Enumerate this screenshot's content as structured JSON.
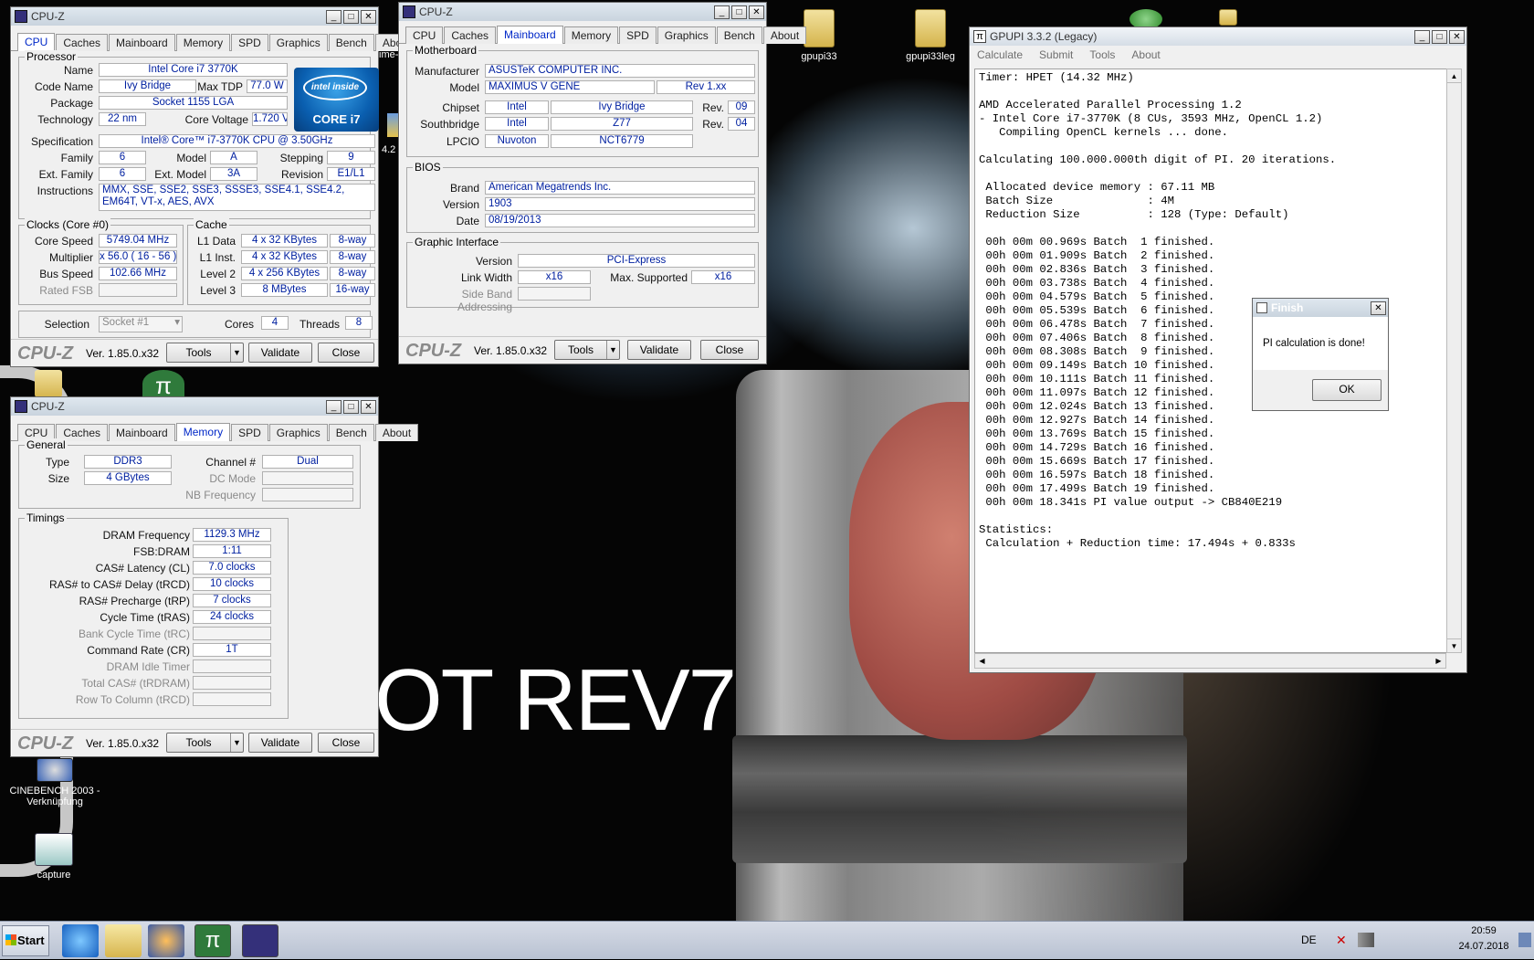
{
  "desktop": {
    "wallpaper_text": "OT REV7",
    "icons": [
      {
        "label": "gpupi33"
      },
      {
        "label": "gpupi33leg"
      },
      {
        "label": "CINEBENCH 2003 - Verknüpfung"
      },
      {
        "label": "capture"
      }
    ],
    "partial_label": "ime-",
    "partial_label2": "4.2"
  },
  "cpuz_cpu": {
    "title": "CPU-Z",
    "tabs": [
      "CPU",
      "Caches",
      "Mainboard",
      "Memory",
      "SPD",
      "Graphics",
      "Bench",
      "About"
    ],
    "active_tab": "CPU",
    "processor_group": "Processor",
    "name_label": "Name",
    "name": "Intel Core i7 3770K",
    "codename_label": "Code Name",
    "codename": "Ivy Bridge",
    "maxtdp_label": "Max TDP",
    "maxtdp": "77.0 W",
    "package_label": "Package",
    "package": "Socket 1155 LGA",
    "tech_label": "Technology",
    "tech": "22 nm",
    "corevolt_label": "Core Voltage",
    "corevolt": "1.720 V",
    "spec_label": "Specification",
    "spec": "Intel® Core™ i7-3770K CPU @ 3.50GHz",
    "family_label": "Family",
    "family": "6",
    "model_label": "Model",
    "model": "A",
    "stepping_label": "Stepping",
    "stepping": "9",
    "extfam_label": "Ext. Family",
    "extfam": "6",
    "extmodel_label": "Ext. Model",
    "extmodel": "3A",
    "revision_label": "Revision",
    "revision": "E1/L1",
    "instr_label": "Instructions",
    "instr": "MMX, SSE, SSE2, SSE3, SSSE3, SSE4.1, SSE4.2, EM64T, VT-x, AES, AVX",
    "clocks_group": "Clocks (Core #0)",
    "corespeed_label": "Core Speed",
    "corespeed": "5749.04 MHz",
    "mult_label": "Multiplier",
    "mult": "x 56.0 ( 16 - 56 )",
    "bus_label": "Bus Speed",
    "bus": "102.66 MHz",
    "fsb_label": "Rated FSB",
    "fsb": "",
    "cache_group": "Cache",
    "l1d_label": "L1 Data",
    "l1d": "4 x 32 KBytes",
    "l1d_way": "8-way",
    "l1i_label": "L1 Inst.",
    "l1i": "4 x 32 KBytes",
    "l1i_way": "8-way",
    "l2_label": "Level 2",
    "l2": "4 x 256 KBytes",
    "l2_way": "8-way",
    "l3_label": "Level 3",
    "l3": "8 MBytes",
    "l3_way": "16-way",
    "sel_label": "Selection",
    "sel": "Socket #1",
    "cores_label": "Cores",
    "cores": "4",
    "threads_label": "Threads",
    "threads": "8",
    "intel_logo": "intel inside",
    "intel_core": "CORE i7"
  },
  "cpuz_footer": {
    "logo": "CPU-Z",
    "version": "Ver. 1.85.0.x32",
    "tools": "Tools",
    "validate": "Validate",
    "close": "Close"
  },
  "cpuz_mb": {
    "title": "CPU-Z",
    "active_tab": "Mainboard",
    "mb_group": "Motherboard",
    "manuf_label": "Manufacturer",
    "manuf": "ASUSTeK COMPUTER INC.",
    "model_label": "Model",
    "model": "MAXIMUS V GENE",
    "model_rev": "Rev 1.xx",
    "chipset_label": "Chipset",
    "chipset_v": "Intel",
    "chipset_n": "Ivy Bridge",
    "chipset_rev_label": "Rev.",
    "chipset_rev": "09",
    "south_label": "Southbridge",
    "south_v": "Intel",
    "south_n": "Z77",
    "south_rev_label": "Rev.",
    "south_rev": "04",
    "lpcio_label": "LPCIO",
    "lpcio_v": "Nuvoton",
    "lpcio_n": "NCT6779",
    "bios_group": "BIOS",
    "brand_label": "Brand",
    "brand": "American Megatrends Inc.",
    "version_label": "Version",
    "version": "1903",
    "date_label": "Date",
    "date": "08/19/2013",
    "gi_group": "Graphic Interface",
    "giver_label": "Version",
    "giver": "PCI-Express",
    "lw_label": "Link Width",
    "lw": "x16",
    "maxsup_label": "Max. Supported",
    "maxsup": "x16",
    "sba_label": "Side Band Addressing",
    "sba": ""
  },
  "cpuz_mem": {
    "title": "CPU-Z",
    "active_tab": "Memory",
    "gen_group": "General",
    "type_label": "Type",
    "type": "DDR3",
    "size_label": "Size",
    "size": "4 GBytes",
    "channel_label": "Channel #",
    "channel": "Dual",
    "dc_label": "DC Mode",
    "dc": "",
    "nb_label": "NB Frequency",
    "nb": "",
    "tim_group": "Timings",
    "rows": [
      {
        "l": "DRAM Frequency",
        "v": "1129.3 MHz",
        "dim": false
      },
      {
        "l": "FSB:DRAM",
        "v": "1:11",
        "dim": false
      },
      {
        "l": "CAS# Latency (CL)",
        "v": "7.0 clocks",
        "dim": false
      },
      {
        "l": "RAS# to CAS# Delay (tRCD)",
        "v": "10 clocks",
        "dim": false
      },
      {
        "l": "RAS# Precharge (tRP)",
        "v": "7 clocks",
        "dim": false
      },
      {
        "l": "Cycle Time (tRAS)",
        "v": "24 clocks",
        "dim": false
      },
      {
        "l": "Bank Cycle Time (tRC)",
        "v": "",
        "dim": true
      },
      {
        "l": "Command Rate (CR)",
        "v": "1T",
        "dim": false
      },
      {
        "l": "DRAM Idle Timer",
        "v": "",
        "dim": true
      },
      {
        "l": "Total CAS# (tRDRAM)",
        "v": "",
        "dim": true
      },
      {
        "l": "Row To Column (tRCD)",
        "v": "",
        "dim": true
      }
    ]
  },
  "gpupi": {
    "title": "GPUPI 3.3.2 (Legacy)",
    "menu": [
      "Calculate",
      "Submit",
      "Tools",
      "About"
    ],
    "output": "Timer: HPET (14.32 MHz)\n\nAMD Accelerated Parallel Processing 1.2\n- Intel Core i7-3770K (8 CUs, 3593 MHz, OpenCL 1.2)\n   Compiling OpenCL kernels ... done.\n\nCalculating 100.000.000th digit of PI. 20 iterations.\n\n Allocated device memory : 67.11 MB\n Batch Size              : 4M\n Reduction Size          : 128 (Type: Default)\n\n 00h 00m 00.969s Batch  1 finished.\n 00h 00m 01.909s Batch  2 finished.\n 00h 00m 02.836s Batch  3 finished.\n 00h 00m 03.738s Batch  4 finished.\n 00h 00m 04.579s Batch  5 finished.\n 00h 00m 05.539s Batch  6 finished.\n 00h 00m 06.478s Batch  7 finished.\n 00h 00m 07.406s Batch  8 finished.\n 00h 00m 08.308s Batch  9 finished.\n 00h 00m 09.149s Batch 10 finished.\n 00h 00m 10.111s Batch 11 finished.\n 00h 00m 11.097s Batch 12 finished.\n 00h 00m 12.024s Batch 13 finished.\n 00h 00m 12.927s Batch 14 finished.\n 00h 00m 13.769s Batch 15 finished.\n 00h 00m 14.729s Batch 16 finished.\n 00h 00m 15.669s Batch 17 finished.\n 00h 00m 16.597s Batch 18 finished.\n 00h 00m 17.499s Batch 19 finished.\n 00h 00m 18.341s PI value output -> CB840E219\n\nStatistics:\n Calculation + Reduction time: 17.494s + 0.833s"
  },
  "dialog": {
    "title": "Finish",
    "message": "PI calculation is done!",
    "ok": "OK"
  },
  "taskbar": {
    "start": "Start",
    "lang": "DE",
    "time": "20:59",
    "date": "24.07.2018"
  }
}
